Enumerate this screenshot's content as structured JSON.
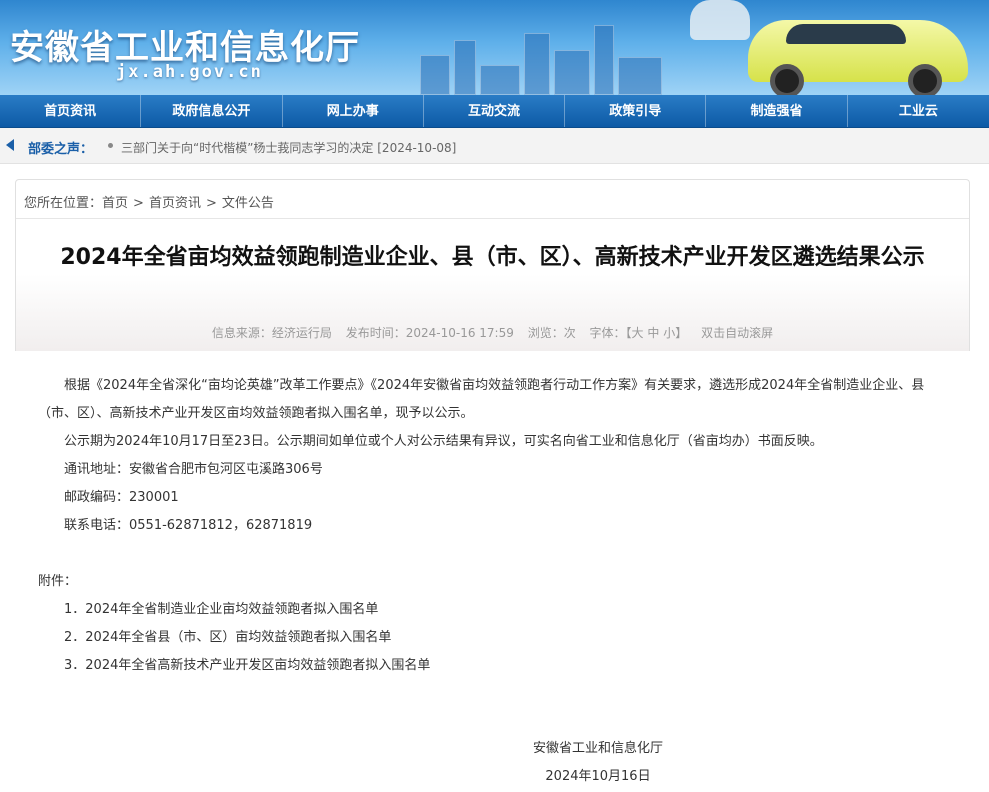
{
  "header": {
    "site_name": "安徽省工业和信息化厅",
    "domain": "jx.ah.gov.cn"
  },
  "nav": {
    "items": [
      "首页资讯",
      "政府信息公开",
      "网上办事",
      "互动交流",
      "政策引导",
      "制造强省",
      "工业云"
    ]
  },
  "announce": {
    "label": "部委之声：",
    "text": "三部门关于向“时代楷模”杨士莪同志学习的决定 [2024-10-08]"
  },
  "breadcrumb": {
    "prefix": "您所在位置：",
    "items": [
      "首页",
      "首页资讯",
      "文件公告"
    ],
    "sep": ">"
  },
  "article": {
    "title": "2024年全省亩均效益领跑制造业企业、县（市、区）、高新技术产业开发区遴选结果公示",
    "meta": {
      "source": "信息来源：经济运行局",
      "time": "发布时间：2024-10-16 17:59",
      "views": "浏览：次",
      "fontsize_prefix": "字体：【",
      "font_large": "大",
      "font_medium": "中",
      "font_small": "小",
      "fontsize_suffix": "】",
      "autoscroll": "双击自动滚屏"
    },
    "paragraphs": [
      "根据《2024年全省深化“亩均论英雄”改革工作要点》《2024年安徽省亩均效益领跑者行动工作方案》有关要求，遴选形成2024年全省制造业企业、县（市、区）、高新技术产业开发区亩均效益领跑者拟入围名单，现予以公示。",
      "公示期为2024年10月17日至23日。公示期间如单位或个人对公示结果有异议，可实名向省工业和信息化厅（省亩均办）书面反映。"
    ],
    "contacts": [
      "通讯地址：安徽省合肥市包河区屯溪路306号",
      "邮政编码：230001",
      "联系电话：0551-62871812，62871819"
    ],
    "attachments_heading": "附件：",
    "attachments": [
      "1．2024年全省制造业企业亩均效益领跑者拟入围名单",
      "2．2024年全省县（市、区）亩均效益领跑者拟入围名单",
      "3．2024年全省高新技术产业开发区亩均效益领跑者拟入围名单"
    ],
    "signature": {
      "org": "安徽省工业和信息化厅",
      "date": "2024年10月16日"
    }
  }
}
